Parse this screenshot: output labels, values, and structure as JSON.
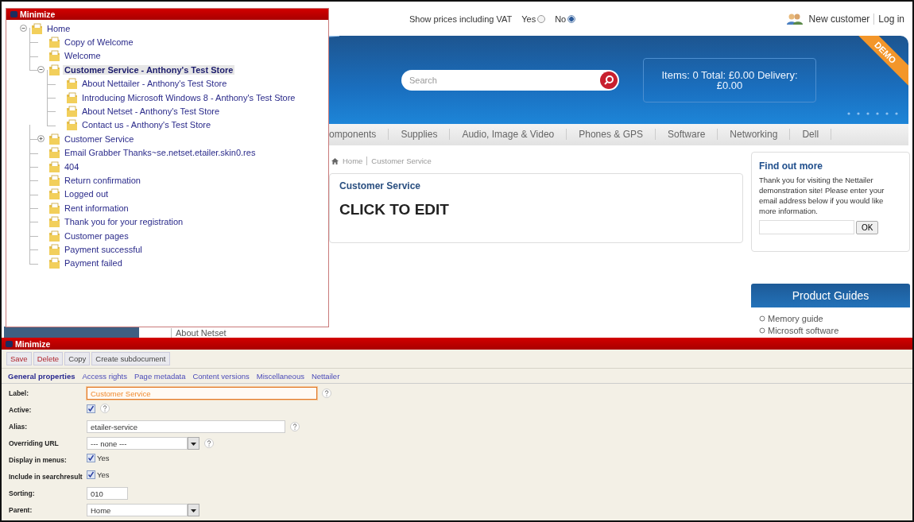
{
  "tree_panel": {
    "header": "Minimize",
    "tree": [
      {
        "label": "Home",
        "expanded": true,
        "selected": false,
        "children": [
          {
            "label": "Copy of Welcome",
            "selected": false
          },
          {
            "label": "Welcome",
            "selected": false
          },
          {
            "label": "Customer Service - Anthony's Test Store",
            "expanded": true,
            "selected": true,
            "children": [
              {
                "label": "About Nettailer - Anthony's Test Store",
                "selected": false
              },
              {
                "label": "Introducing Microsoft Windows 8 - Anthony's Test Store",
                "selected": false
              },
              {
                "label": "About Netset - Anthony's Test Store",
                "selected": false
              },
              {
                "label": "Contact us - Anthony's Test Store",
                "selected": false
              }
            ]
          },
          {
            "label": "Customer Service",
            "expanded": false,
            "selected": false
          },
          {
            "label": "Email Grabber Thanks~se.netset.etailer.skin0.res",
            "selected": false
          },
          {
            "label": "404",
            "selected": false
          },
          {
            "label": "Return confirmation",
            "selected": false
          },
          {
            "label": "Logged out",
            "selected": false
          },
          {
            "label": "Rent information",
            "selected": false
          },
          {
            "label": "Thank you for your registration",
            "selected": false
          },
          {
            "label": "Customer pages",
            "selected": false
          },
          {
            "label": "Payment successful",
            "selected": false
          },
          {
            "label": "Payment failed",
            "selected": false
          }
        ]
      }
    ]
  },
  "site": {
    "vat": {
      "label": "Show prices including VAT",
      "options": [
        {
          "label": "Yes",
          "selected": false
        },
        {
          "label": "No",
          "selected": true
        }
      ]
    },
    "account_links": [
      "New customer",
      "Log in"
    ],
    "search": {
      "placeholder": "Search"
    },
    "cart": "Items: 0  Total: £0.00 Delivery: £0.00",
    "ribbon": "DEMO",
    "nav": [
      "omponents",
      "Supplies",
      "Audio, Image & Video",
      "Phones & GPS",
      "Software",
      "Networking",
      "Dell"
    ],
    "breadcrumb": [
      "Home",
      "Customer Service"
    ],
    "content": {
      "heading": "Customer Service",
      "body": "CLICK TO EDIT"
    },
    "find_out_more": {
      "title": "Find out more",
      "text": "Thank you for visiting the Nettailer demonstration site! Please enter your email address below if you would like more information.",
      "button": "OK"
    },
    "product_guides": {
      "title": "Product Guides",
      "items": [
        "Memory guide",
        "Microsoft software"
      ]
    },
    "side_nav_item": "About Netset"
  },
  "editor": {
    "header": "Minimize",
    "buttons": [
      {
        "label": "Save",
        "kind": "danger"
      },
      {
        "label": "Delete",
        "kind": "danger"
      },
      {
        "label": "Copy",
        "kind": "normal"
      },
      {
        "label": "Create subdocument",
        "kind": "normal"
      }
    ],
    "tabs": [
      {
        "label": "General properties",
        "selected": true
      },
      {
        "label": "Access rights",
        "selected": false
      },
      {
        "label": "Page metadata",
        "selected": false
      },
      {
        "label": "Content versions",
        "selected": false
      },
      {
        "label": "Miscellaneous",
        "selected": false
      },
      {
        "label": "Nettailer",
        "selected": false
      }
    ],
    "fields": [
      {
        "label": "Label:",
        "kind": "text",
        "value": "Customer Service",
        "focused": true,
        "help": true
      },
      {
        "label": "Active:",
        "kind": "checkbox",
        "checked": true,
        "help": true
      },
      {
        "label": "Alias:",
        "kind": "text",
        "value": "etailer-service",
        "focused": false,
        "help": true
      },
      {
        "label": "Overriding URL",
        "kind": "select",
        "value": "--- none ---",
        "focused": false,
        "help": true
      },
      {
        "label": "Display in menus:",
        "kind": "checkbox",
        "checked": true,
        "value": "Yes",
        "help": false
      },
      {
        "label": "Include in searchresult",
        "kind": "checkbox",
        "checked": true,
        "value": "Yes",
        "help": false
      },
      {
        "label": "Sorting:",
        "kind": "short",
        "value": "010",
        "focused": false,
        "help": false
      },
      {
        "label": "Parent:",
        "kind": "select",
        "value": "Home",
        "focused": false,
        "help": false
      }
    ]
  }
}
